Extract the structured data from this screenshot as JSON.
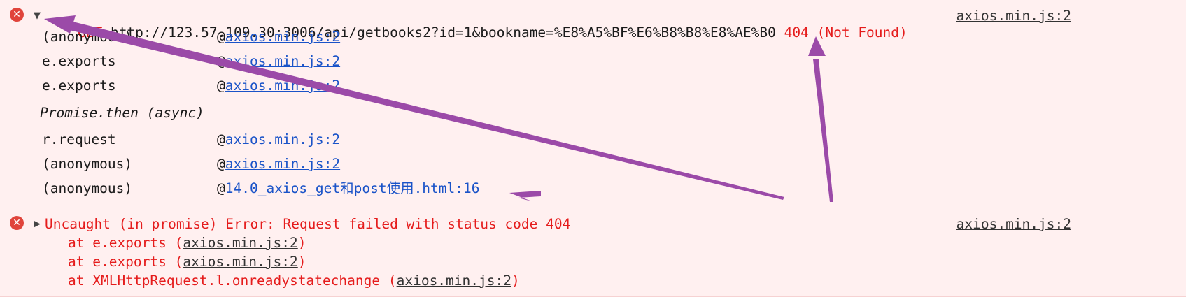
{
  "entry1": {
    "method": "GET",
    "url": "http://123.57.109.30:3006/api/getbooks2?id=1&bookname=%E8%A5%BF%E6%B8%B8%E8%AE%B0",
    "status": "404 (Not Found)",
    "source": "axios.min.js:2",
    "stack": [
      {
        "fn": "(anonymous)",
        "at": "@",
        "link": "axios.min.js:2"
      },
      {
        "fn": "e.exports",
        "at": "@",
        "link": "axios.min.js:2"
      },
      {
        "fn": "e.exports",
        "at": "@",
        "link": "axios.min.js:2"
      },
      {
        "fn": "Promise.then (async)"
      },
      {
        "fn": "r.request",
        "at": "@",
        "link": "axios.min.js:2"
      },
      {
        "fn": "(anonymous)",
        "at": "@",
        "link": "axios.min.js:2"
      },
      {
        "fn": "(anonymous)",
        "at": "@",
        "link": "14.0_axios_get和post使用.html:16"
      }
    ]
  },
  "entry2": {
    "message": "Uncaught (in promise) Error: Request failed with status code 404",
    "source": "axios.min.js:2",
    "trace": [
      {
        "prefix": "at e.exports (",
        "link": "axios.min.js:2",
        "suffix": ")"
      },
      {
        "prefix": "at e.exports (",
        "link": "axios.min.js:2",
        "suffix": ")"
      },
      {
        "prefix": "at XMLHttpRequest.l.onreadystatechange (",
        "link": "axios.min.js:2",
        "suffix": ")"
      }
    ]
  },
  "icons": {
    "error": "error-circle-icon",
    "expanded": "triangle-down-icon",
    "collapsed": "triangle-right-icon"
  },
  "colors": {
    "background": "#fff0f0",
    "error_text": "#e51c1c",
    "link": "#1a53c8",
    "annotation_arrow": "#9b4aa8"
  }
}
